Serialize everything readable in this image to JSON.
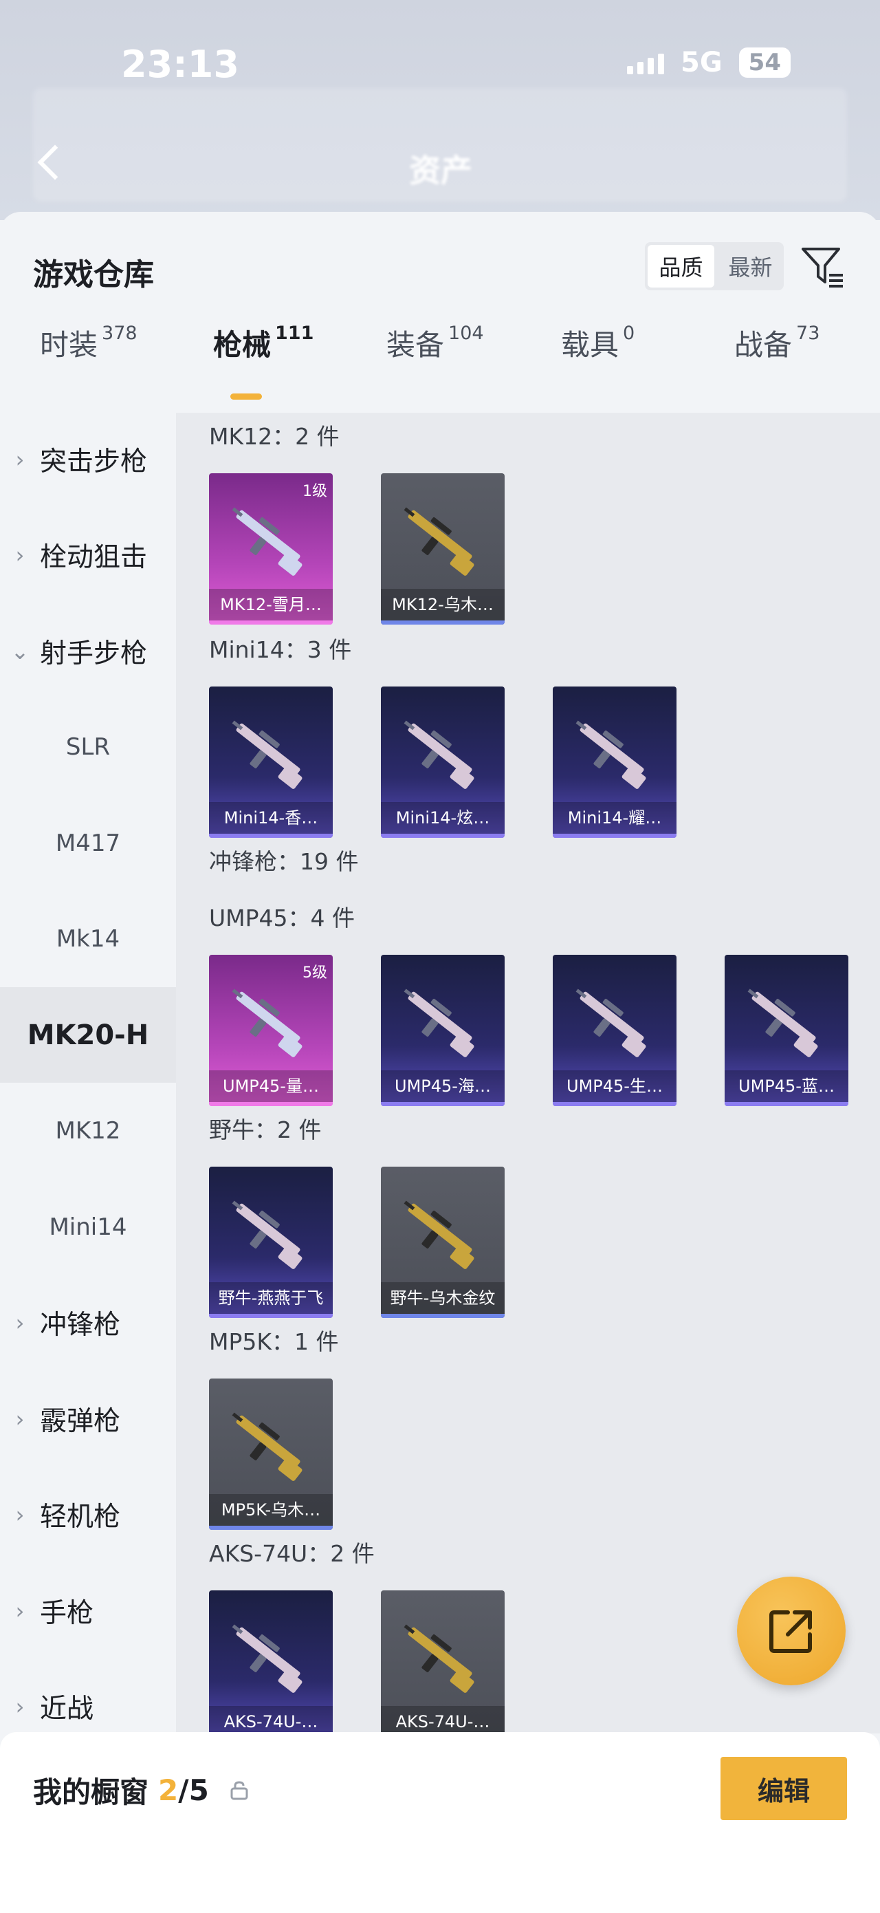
{
  "status": {
    "time": "23:13",
    "network": "5G",
    "battery": "54"
  },
  "header": {
    "title": "资产"
  },
  "sheet": {
    "title": "游戏仓库",
    "sort": [
      "品质",
      "最新"
    ],
    "sort_active": "品质"
  },
  "tabs": [
    {
      "label": "时装",
      "count": "378"
    },
    {
      "label": "枪械",
      "count": "111"
    },
    {
      "label": "装备",
      "count": "104"
    },
    {
      "label": "载具",
      "count": "0"
    },
    {
      "label": "战备",
      "count": "73"
    }
  ],
  "sidebar": {
    "items": [
      {
        "label": "突击步枪",
        "type": "cat",
        "arrow": "›"
      },
      {
        "label": "栓动狙击",
        "type": "cat",
        "arrow": "›"
      },
      {
        "label": "射手步枪",
        "type": "cat",
        "arrow": "⌄"
      },
      {
        "label": "SLR",
        "type": "sub"
      },
      {
        "label": "M417",
        "type": "sub"
      },
      {
        "label": "Mk14",
        "type": "sub"
      },
      {
        "label": "MK20-H",
        "type": "sub",
        "active": true
      },
      {
        "label": "MK12",
        "type": "sub"
      },
      {
        "label": "Mini14",
        "type": "sub"
      },
      {
        "label": "冲锋枪",
        "type": "cat",
        "arrow": "›"
      },
      {
        "label": "霰弹枪",
        "type": "cat",
        "arrow": "›"
      },
      {
        "label": "轻机枪",
        "type": "cat",
        "arrow": "›"
      },
      {
        "label": "手枪",
        "type": "cat",
        "arrow": "›"
      },
      {
        "label": "近战",
        "type": "cat",
        "arrow": "›"
      }
    ]
  },
  "groups": [
    {
      "title": "MK12：2 件",
      "items": [
        {
          "name": "MK12-雪月…",
          "style": "pink",
          "level": "1级"
        },
        {
          "name": "MK12-乌木…",
          "style": "gray",
          "level": ""
        }
      ]
    },
    {
      "title": "Mini14：3 件",
      "items": [
        {
          "name": "Mini14-香…",
          "style": "purple",
          "level": ""
        },
        {
          "name": "Mini14-炫…",
          "style": "purple",
          "level": ""
        },
        {
          "name": "Mini14-耀…",
          "style": "purple",
          "level": ""
        }
      ]
    },
    {
      "title": "冲锋枪：19 件",
      "items": []
    },
    {
      "title": "UMP45：4 件",
      "items": [
        {
          "name": "UMP45-量…",
          "style": "pink",
          "level": "5级"
        },
        {
          "name": "UMP45-海…",
          "style": "purple",
          "level": ""
        },
        {
          "name": "UMP45-生…",
          "style": "purple",
          "level": ""
        },
        {
          "name": "UMP45-蓝…",
          "style": "purple",
          "level": ""
        }
      ]
    },
    {
      "title": "野牛：2 件",
      "items": [
        {
          "name": "野牛-燕燕于飞",
          "style": "purple",
          "level": ""
        },
        {
          "name": "野牛-乌木金纹",
          "style": "gray",
          "level": ""
        }
      ]
    },
    {
      "title": "MP5K：1 件",
      "items": [
        {
          "name": "MP5K-乌木…",
          "style": "gray",
          "level": ""
        }
      ]
    },
    {
      "title": "AKS-74U：2 件",
      "items": [
        {
          "name": "AKS-74U-…",
          "style": "purple",
          "level": ""
        },
        {
          "name": "AKS-74U-…",
          "style": "gray",
          "level": ""
        }
      ]
    }
  ],
  "bottom": {
    "showcase_label": "我的橱窗",
    "showcase_count": "2",
    "showcase_total": "/5",
    "edit_label": "编辑"
  },
  "colors": {
    "accent": "#f3b23a",
    "pink_card": "#c84fc8",
    "purple_card": "#2b2a6a",
    "gray_card": "#555861"
  }
}
